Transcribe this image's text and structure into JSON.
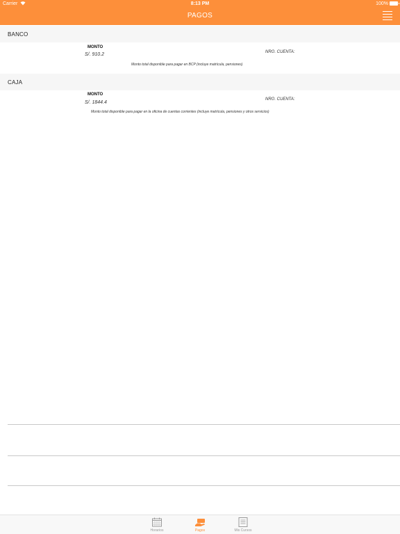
{
  "status_bar": {
    "carrier": "Carrier",
    "time": "8:13 PM",
    "battery": "100%"
  },
  "header": {
    "title": "PAGOS",
    "menu_icon": "hamburger-icon"
  },
  "banco": {
    "title": "BANCO",
    "monto_label": "MONTO",
    "monto_value": "S/. 910.2",
    "cuenta_label": "NRO. CUENTA:",
    "note": "Monto total disponible para pagar en BCP (incluye matrícula, pensiones)"
  },
  "caja": {
    "title": "CAJA",
    "monto_label": "MONTO",
    "monto_value": "S/. 1844.4",
    "cuenta_label": "NRO. CUENTA:",
    "note": "Monto total disponible para pagar en la oficina de cuentas corrientes (incluye matrícula, pensiones y otros servicios)"
  },
  "tabs": [
    {
      "label": "Horarios",
      "icon": "calendar-icon"
    },
    {
      "label": "Pagos",
      "icon": "payment-icon"
    },
    {
      "label": "Mis Cursos",
      "icon": "list-icon"
    }
  ],
  "colors": {
    "accent": "#fd8f3a",
    "section_bg": "#f6f6f6"
  }
}
